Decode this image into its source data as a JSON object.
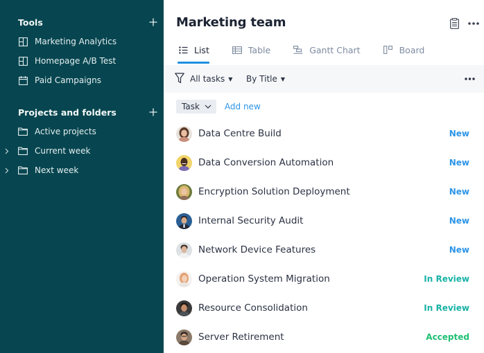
{
  "sidebar": {
    "sections": [
      {
        "title": "Tools",
        "add_icon": "plus-icon",
        "items": [
          {
            "label": "Marketing Analytics",
            "icon": "dashboard-icon",
            "expandable": false
          },
          {
            "label": "Homepage A/B Test",
            "icon": "dashboard-icon",
            "expandable": false
          },
          {
            "label": "Paid Campaigns",
            "icon": "calendar-icon",
            "expandable": false
          }
        ]
      },
      {
        "title": "Projects and folders",
        "add_icon": "plus-icon",
        "items": [
          {
            "label": "Active projects",
            "icon": "folder-icon",
            "expandable": false
          },
          {
            "label": "Current week",
            "icon": "folder-icon",
            "expandable": true
          },
          {
            "label": "Next week",
            "icon": "folder-icon",
            "expandable": true
          }
        ]
      }
    ]
  },
  "header": {
    "title": "Marketing team",
    "icons": [
      "clipboard-icon",
      "more-icon"
    ]
  },
  "tabs": [
    {
      "label": "List",
      "icon": "list-icon",
      "active": true
    },
    {
      "label": "Table",
      "icon": "table-icon",
      "active": false
    },
    {
      "label": "Gantt Chart",
      "icon": "gantt-icon",
      "active": false
    },
    {
      "label": "Board",
      "icon": "board-icon",
      "active": false
    }
  ],
  "toolbar": {
    "filter_icon": "filter-icon",
    "filter_label": "All tasks",
    "sort_label": "By Title",
    "more_icon": "more-icon"
  },
  "taskbar": {
    "type_label": "Task",
    "add_new_label": "Add new"
  },
  "tasks": [
    {
      "name": "Data Centre Build",
      "status": "New"
    },
    {
      "name": "Data Conversion Automation",
      "status": "New"
    },
    {
      "name": "Encryption Solution Deployment",
      "status": "New"
    },
    {
      "name": "Internal Security Audit",
      "status": "New"
    },
    {
      "name": "Network Device Features",
      "status": "New"
    },
    {
      "name": "Operation System Migration",
      "status": "In Review"
    },
    {
      "name": "Resource Consolidation",
      "status": "In Review"
    },
    {
      "name": "Server Retirement",
      "status": "Accepted"
    }
  ],
  "colors": {
    "sidebar_bg": "#074650",
    "accent": "#1e8fe0",
    "status_new": "#2d95e6",
    "status_in_review": "#19b3a6",
    "status_accepted": "#1fbf73"
  }
}
